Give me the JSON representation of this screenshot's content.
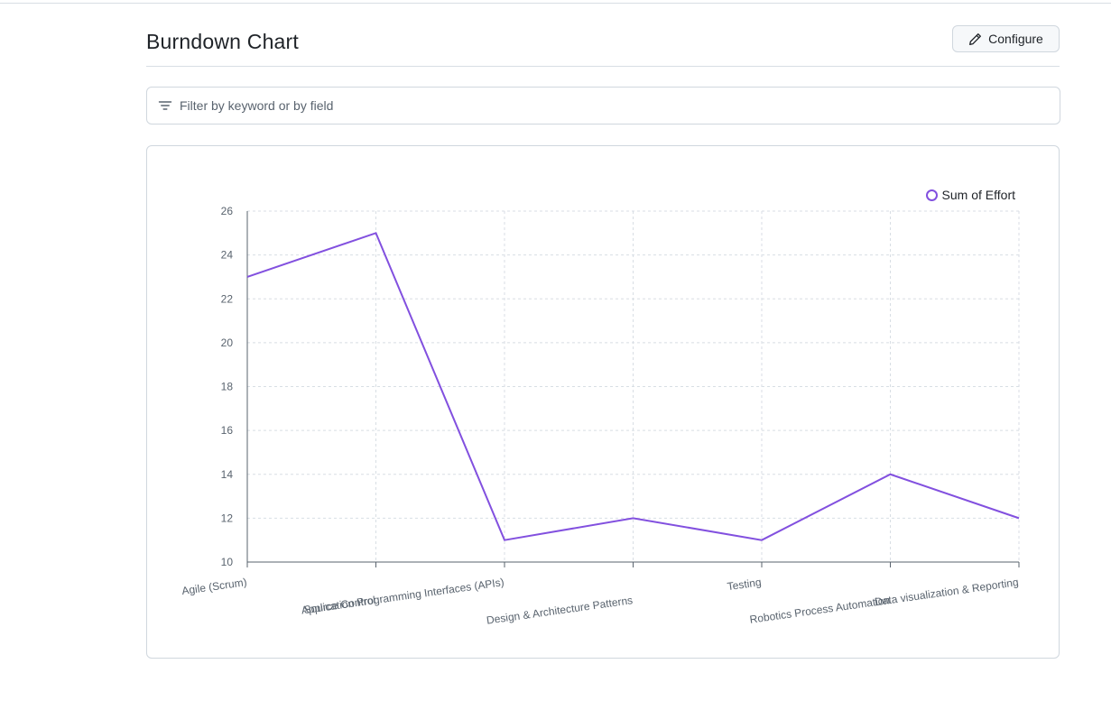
{
  "header": {
    "title": "Burndown Chart",
    "configure_label": "Configure"
  },
  "filter": {
    "placeholder": "Filter by keyword or by field"
  },
  "icons": {
    "configure": "pencil-icon",
    "filter": "filter-icon",
    "legend": "circle-outline-icon"
  },
  "colors": {
    "series": "#8250df",
    "grid": "#d8dee4",
    "axis": "#59636e"
  },
  "chart_data": {
    "type": "line",
    "categories": [
      "Agile (Scrum)",
      "Source Control",
      "Application Programming Interfaces (APIs)",
      "Design & Architecture Patterns",
      "Testing",
      "Robotics Process Automation",
      "Data visualization & Reporting"
    ],
    "series": [
      {
        "name": "Sum of Effort",
        "values": [
          23,
          25,
          11,
          12,
          11,
          14,
          12
        ]
      }
    ],
    "ylim": [
      10,
      26
    ],
    "yticks": [
      10,
      12,
      14,
      16,
      18,
      20,
      22,
      24,
      26
    ],
    "grid": true,
    "legend": "top-right"
  }
}
